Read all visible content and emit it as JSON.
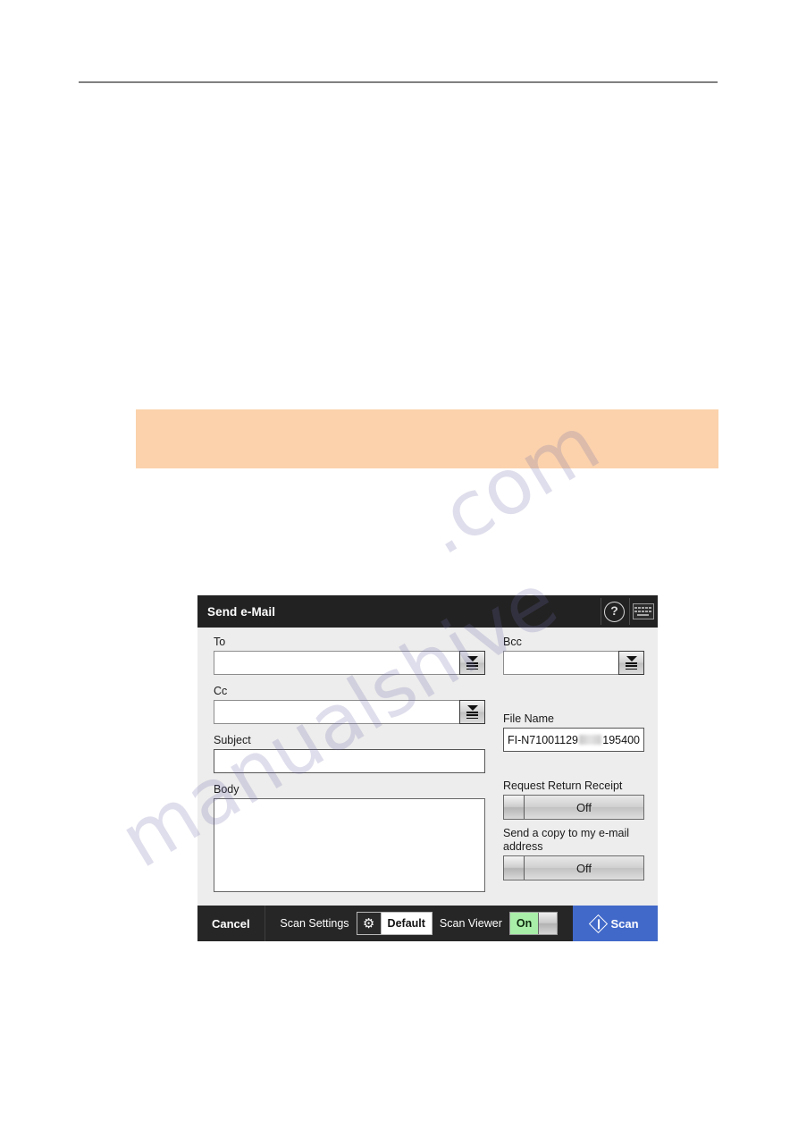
{
  "page": {
    "rule": "horizontal-rule",
    "note_banner": ""
  },
  "dialog": {
    "title": "Send e-Mail",
    "icons": {
      "help": "help-icon",
      "keyboard": "keyboard-icon"
    },
    "fields": {
      "to": {
        "label": "To",
        "value": "",
        "address_book": "address-book-icon"
      },
      "cc": {
        "label": "Cc",
        "value": "",
        "address_book": "address-book-icon"
      },
      "bcc": {
        "label": "Bcc",
        "value": "",
        "address_book": "address-book-icon"
      },
      "subject": {
        "label": "Subject",
        "value": ""
      },
      "body": {
        "label": "Body",
        "value": ""
      },
      "file_name": {
        "label": "File Name",
        "value_prefix": "FI-N71001129",
        "value_suffix": "195400"
      }
    },
    "toggles": {
      "return_receipt": {
        "label": "Request Return Receipt",
        "state": "Off"
      },
      "send_copy": {
        "label": "Send a copy to my e-mail address",
        "state": "Off"
      }
    },
    "footer": {
      "cancel": "Cancel",
      "scan_settings_label": "Scan Settings",
      "scan_settings_value": "Default",
      "gear_icon": "gear-icon",
      "scan_viewer_label": "Scan Viewer",
      "scan_viewer_state": "On",
      "scan_button": "Scan",
      "scan_icon": "scan-diamond-icon"
    }
  },
  "watermark": {
    "line_a": "manualshive",
    "line_b": ".com"
  },
  "colors": {
    "accent_blue": "#4169c9",
    "note_orange": "#fbd2ac",
    "toggle_on_green": "#a9efa9",
    "titlebar_dark": "#222222"
  }
}
